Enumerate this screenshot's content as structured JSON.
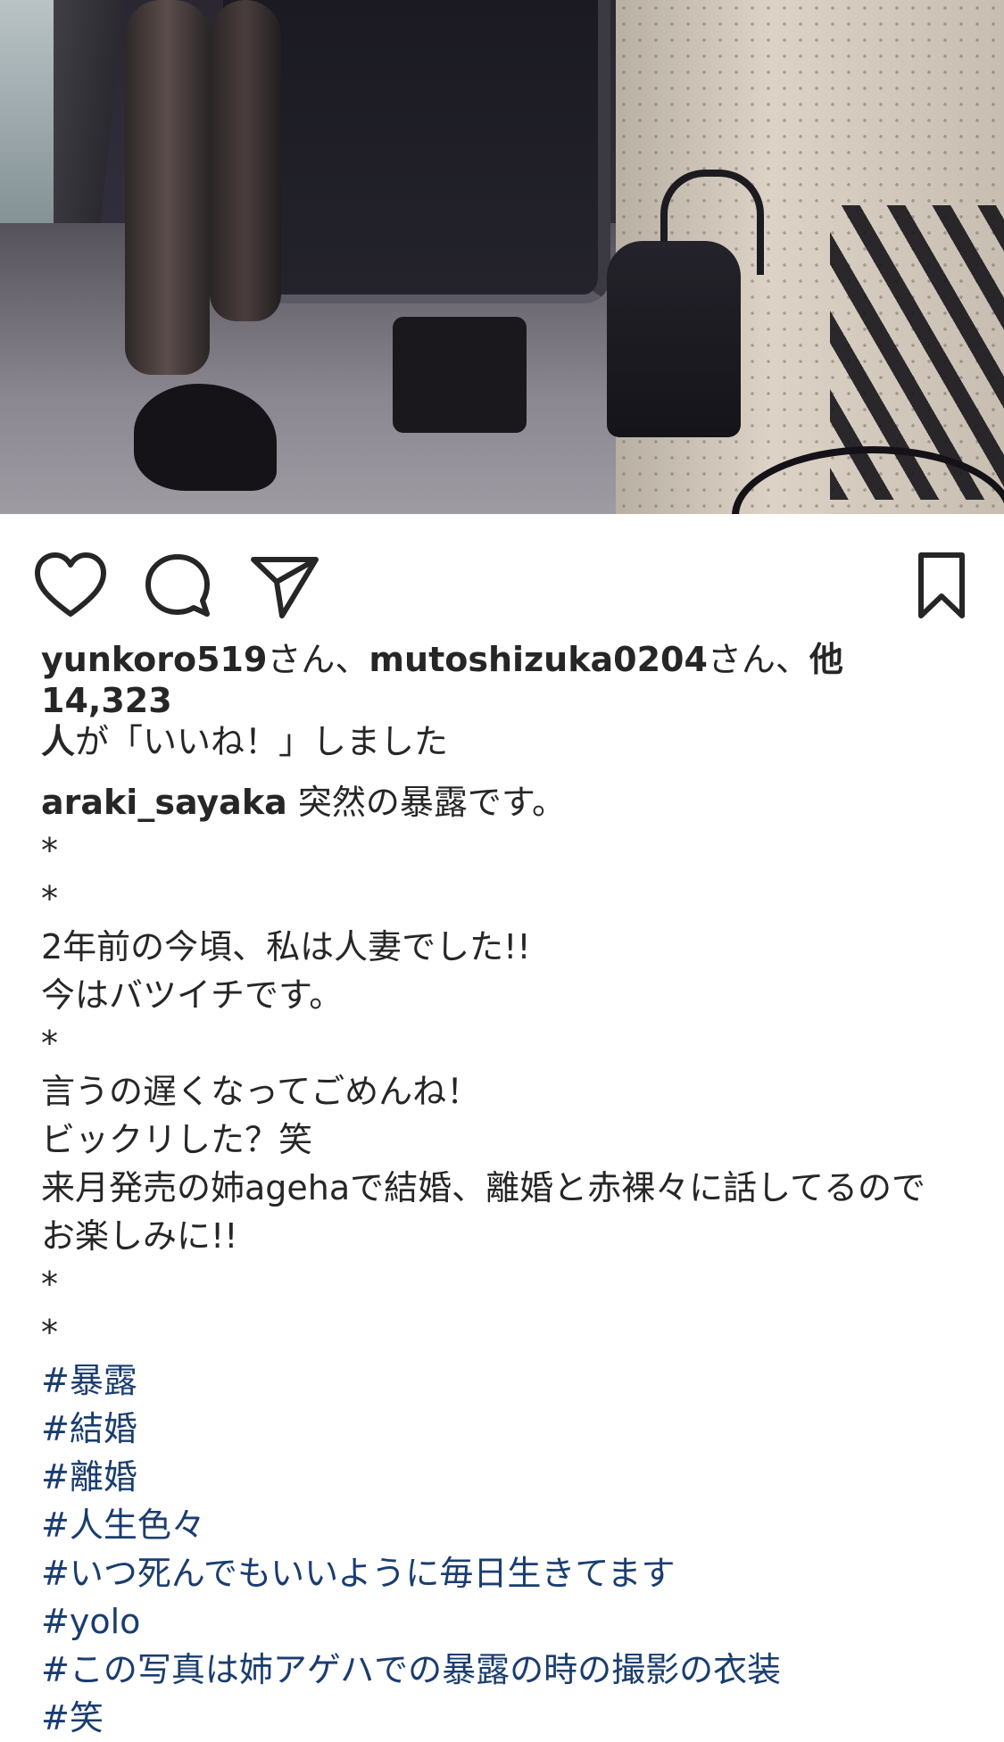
{
  "photo": {
    "alt_subject": "legs in black heels photo"
  },
  "actions": {
    "like_icon": "heart-icon",
    "comment_icon": "comment-icon",
    "share_icon": "paper-plane-icon",
    "save_icon": "bookmark-icon"
  },
  "likes": {
    "user1": "yunkoro519",
    "suffix1": "さん、",
    "user2": "mutoshizuka0204",
    "suffix2": "さん、",
    "others": "他14,323",
    "line2_bold": "人",
    "line2_rest": "が「いいね！」しました"
  },
  "caption": {
    "username": "araki_sayaka",
    "first_line": " 突然の暴露です。",
    "lines": [
      "*",
      "*",
      "2年前の今頃、私は人妻でした!!",
      "今はバツイチです。",
      "*",
      "言うの遅くなってごめんね！",
      "ビックリした？笑"
    ],
    "long_line_a": "来月発売の姉agehaで結婚、離婚と赤裸々に話してるので",
    "long_line_b": "お楽しみに!!",
    "lines_after": [
      "*",
      "*"
    ],
    "hashtags": [
      "#暴露",
      "#結婚",
      "#離婚",
      "#人生色々",
      "#いつ死んでもいいように毎日生きてます",
      "#yolo",
      "#この写真は姉アゲハでの暴露の時の撮影の衣装",
      "#笑"
    ]
  },
  "colors": {
    "text": "#262626",
    "hashtag": "#1a3d70",
    "background": "#ffffff"
  }
}
